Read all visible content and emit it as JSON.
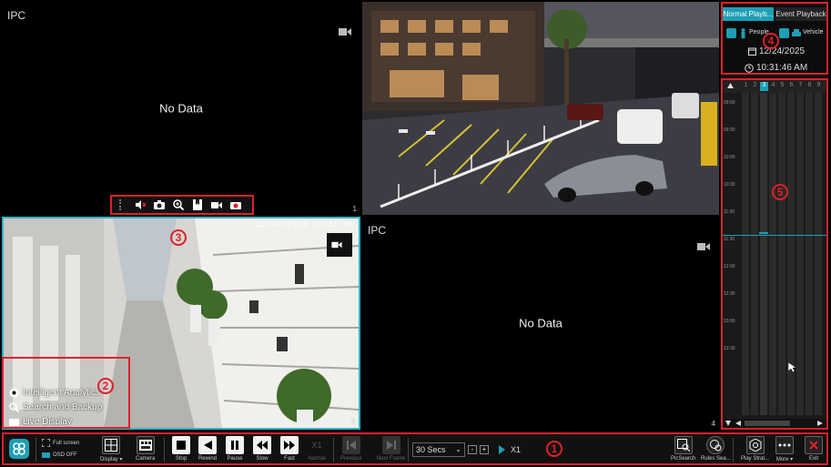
{
  "cells": [
    {
      "label": "IPC",
      "status": "No Data",
      "number": "1"
    },
    {
      "label": "",
      "status": "",
      "number": ""
    },
    {
      "label": "",
      "status": "",
      "number": "3",
      "osd_time": "12/24/2025 10:31:46"
    },
    {
      "label": "IPC",
      "status": "No Data",
      "number": "4"
    }
  ],
  "float_toolbar": {
    "icons": [
      "mute-icon",
      "snapshot-icon",
      "zoom-icon",
      "bookmark-icon",
      "record-icon",
      "smart-icon"
    ]
  },
  "side_menu": {
    "items": [
      {
        "label": "Intelligent Analytics",
        "icon": "analytics-icon"
      },
      {
        "label": "Search and Backup",
        "icon": "search-icon"
      },
      {
        "label": "Live Display",
        "icon": "display-icon"
      }
    ]
  },
  "markers": {
    "m1": "1",
    "m2": "2",
    "m3": "3",
    "m4": "4",
    "m5": "5"
  },
  "right_panel": {
    "tab_normal": "Normal Playb...",
    "tab_event": "Event Playback",
    "people_label": "People",
    "vehicle_label": "Vehicle",
    "date": "12/24/2025",
    "time": "10:31:46 AM",
    "channels": [
      "1",
      "2",
      "3",
      "4",
      "5",
      "6",
      "7",
      "8",
      "9"
    ],
    "selected_channel": "3",
    "time_labels": [
      "09:00",
      "09:30",
      "10:00",
      "10:30",
      "11:00",
      "11:30",
      "12:00",
      "12:30",
      "13:00",
      "13:30"
    ]
  },
  "bottom_bar": {
    "full_screen": "Full screen",
    "osd": "OSD OFF",
    "display": "Display",
    "camera": "Camera",
    "stop": "Stop",
    "rewind": "Rewind",
    "pause": "Pause",
    "slow": "Slow",
    "fast": "Fast",
    "normal": "Normal",
    "speed_badge": "X1",
    "previous": "Previous",
    "next_frame": "Next Frame",
    "interval": "30 Secs",
    "minus": "-",
    "plus": "+",
    "play_speed": "X1",
    "pic_search": "PicSearch",
    "rules": "Rules Sea...",
    "play_strategy": "Play Strat...",
    "more": "More",
    "exit": "Exit"
  },
  "colors": {
    "accent": "#1d9fb5",
    "highlight": "#e0202a",
    "cell_border": "#2fb5c9"
  }
}
